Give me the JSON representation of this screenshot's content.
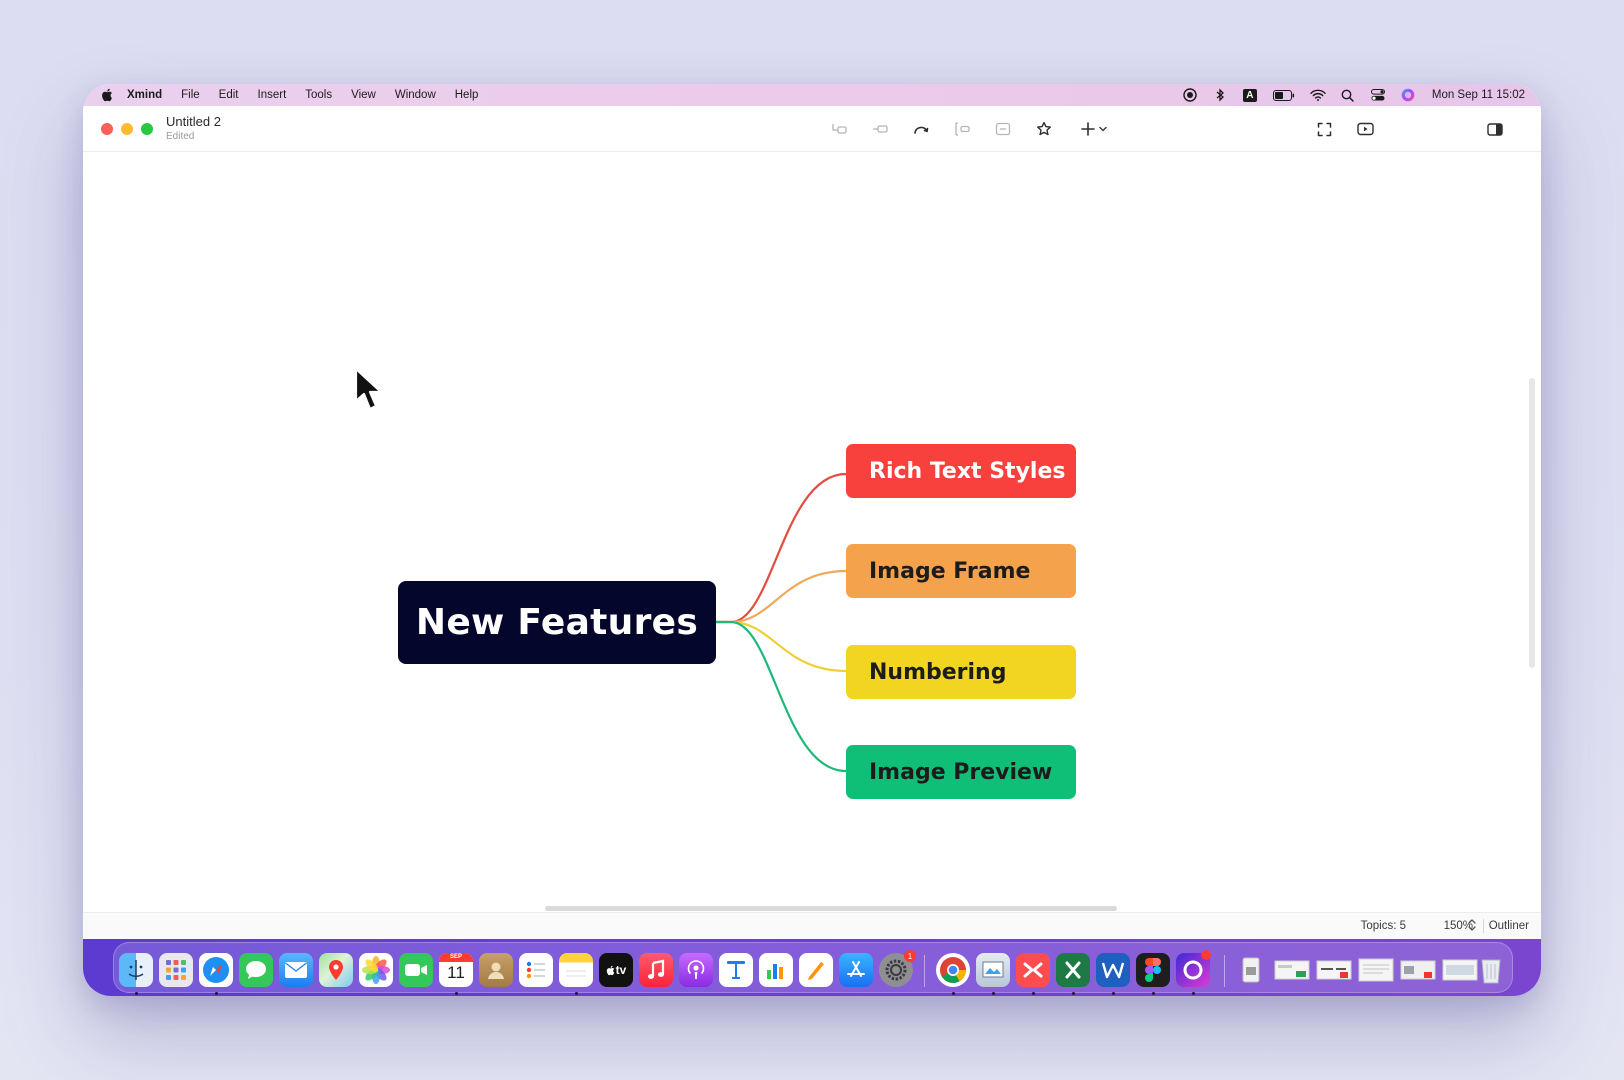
{
  "menubar": {
    "app_name": "Xmind",
    "items": [
      "File",
      "Edit",
      "Insert",
      "Tools",
      "View",
      "Window",
      "Help"
    ],
    "status_icons": [
      "screen-record-icon",
      "bluetooth-icon",
      "input-source-icon",
      "battery-icon",
      "wifi-icon",
      "spotlight-search-icon",
      "control-center-icon",
      "siri-icon"
    ],
    "input_source_label": "A",
    "datetime": "Mon Sep 11  15:02"
  },
  "window": {
    "title": "Untitled 2",
    "subtitle": "Edited"
  },
  "toolbar": {
    "buttons": [
      "insert-subtopic",
      "insert-topic",
      "relationship",
      "boundary",
      "summary",
      "marker",
      "insert-menu",
      "zen-mode",
      "pitch-mode",
      "sidebar-toggle"
    ]
  },
  "mindmap": {
    "central": "New Features",
    "central_color": "#05062b",
    "topics": [
      {
        "label": "Rich Text Styles",
        "color": "#f8413c",
        "text_color": "#ffffff",
        "line_color": "#e24d42"
      },
      {
        "label": "Image Frame",
        "color": "#f4a34c",
        "text_color": "#1c1c1c",
        "line_color": "#eeaa5a"
      },
      {
        "label": "Numbering",
        "color": "#f2d520",
        "text_color": "#1c1c1c",
        "line_color": "#efcf35"
      },
      {
        "label": "Image Preview",
        "color": "#0fbf78",
        "text_color": "#1c1c1c",
        "line_color": "#1db97a"
      }
    ]
  },
  "statusbar": {
    "topics": "Topics: 5",
    "zoom": "150%",
    "outliner": "Outliner"
  },
  "dock": {
    "apps": [
      "Finder",
      "Launchpad",
      "Safari",
      "Messages",
      "Mail",
      "Maps",
      "Photos",
      "FaceTime",
      "Calendar",
      "Contacts",
      "Reminders",
      "Notes",
      "TV",
      "Music",
      "Podcasts",
      "Keynote",
      "Numbers",
      "Pages",
      "App Store",
      "System Settings",
      "Chrome",
      "Preview",
      "Xmind",
      "Excel",
      "Word",
      "Figma",
      "Screen Recorder"
    ],
    "calendar_month": "SEP",
    "calendar_day": "11",
    "tv_label": "tv",
    "settings_badge": "1"
  }
}
